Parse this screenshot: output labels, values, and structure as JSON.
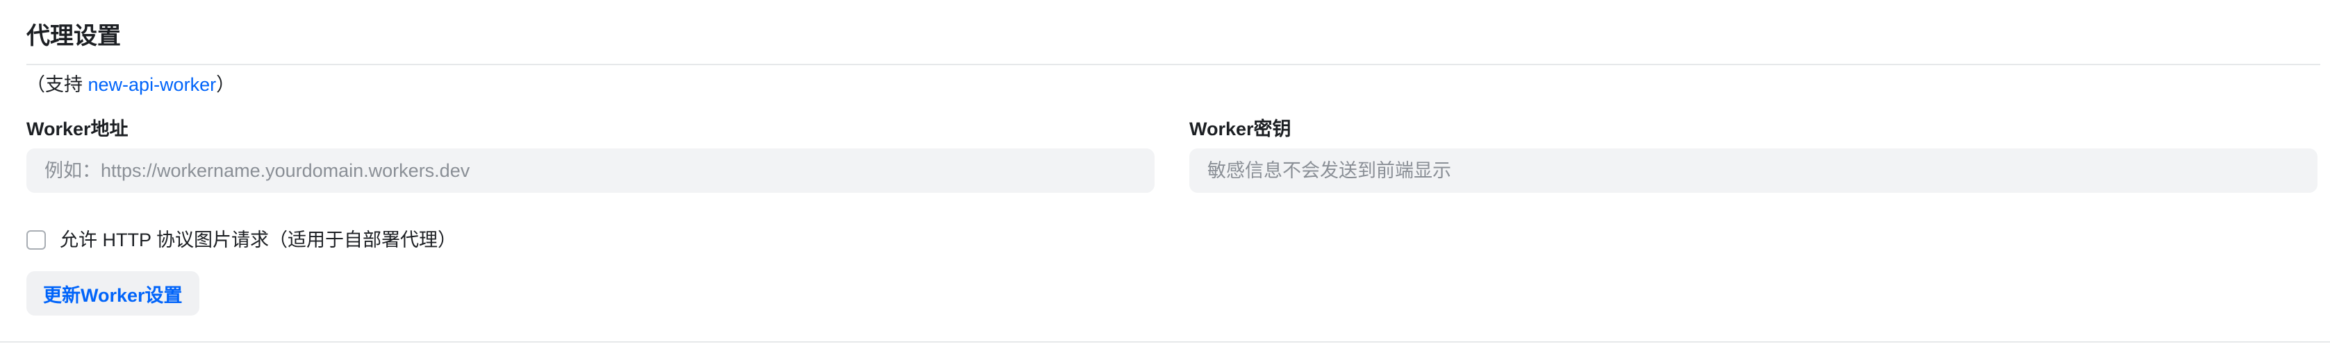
{
  "section": {
    "title": "代理设置"
  },
  "support": {
    "prefix": "（支持 ",
    "link_text": "new-api-worker",
    "suffix": "）"
  },
  "worker_url": {
    "label": "Worker地址",
    "placeholder": "例如：https://workername.yourdomain.workers.dev",
    "value": ""
  },
  "worker_key": {
    "label": "Worker密钥",
    "placeholder": "敏感信息不会发送到前端显示",
    "value": ""
  },
  "allow_http": {
    "label": "允许 HTTP 协议图片请求（适用于自部署代理）",
    "checked": false
  },
  "submit": {
    "label": "更新Worker设置"
  },
  "colors": {
    "link": "#0064fa",
    "button_text": "#0064fa",
    "input_bg": "#f2f3f5"
  }
}
